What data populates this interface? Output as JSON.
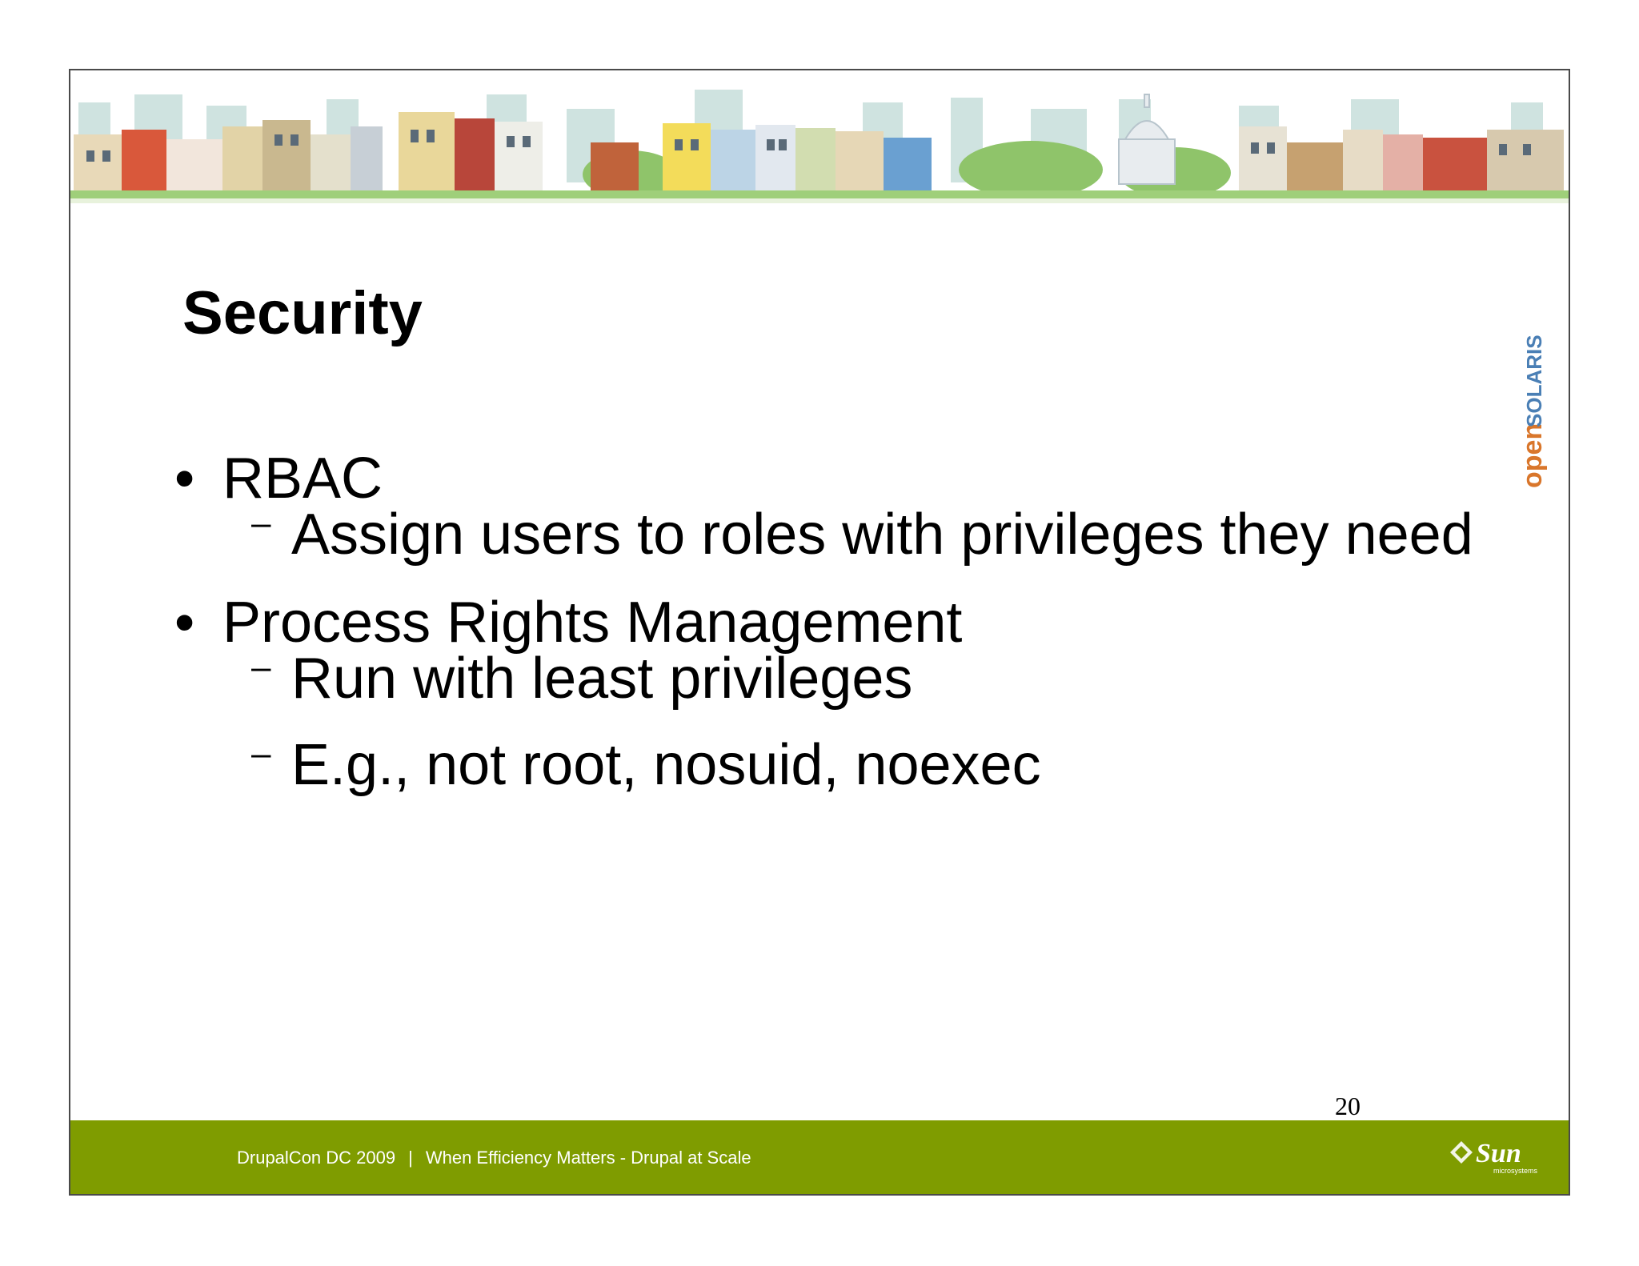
{
  "slide": {
    "title": "Security",
    "bullets": [
      {
        "text": "RBAC",
        "subs": [
          "Assign users to roles with privileges they need"
        ]
      },
      {
        "text": "Process Rights Management",
        "subs": [
          "Run with least privileges",
          "E.g., not root, nosuid, noexec"
        ]
      }
    ],
    "bullet_glyph": "•",
    "sub_glyph": "–",
    "page_number": "20"
  },
  "logos": {
    "side_logo": {
      "part1": "open",
      "part2": "SOLARIS",
      "part1_color": "#d9762b",
      "part2_color": "#4a7fb5"
    },
    "footer_logo": {
      "name": "Sun",
      "sub": "microsystems"
    }
  },
  "footer": {
    "event": "DrupalCon DC 2009",
    "separator": "|",
    "talk": "When Efficiency Matters - Drupal at Scale",
    "bg_color": "#7f9c00"
  },
  "banner": {
    "description_icon": "city-skyline-illustration"
  }
}
